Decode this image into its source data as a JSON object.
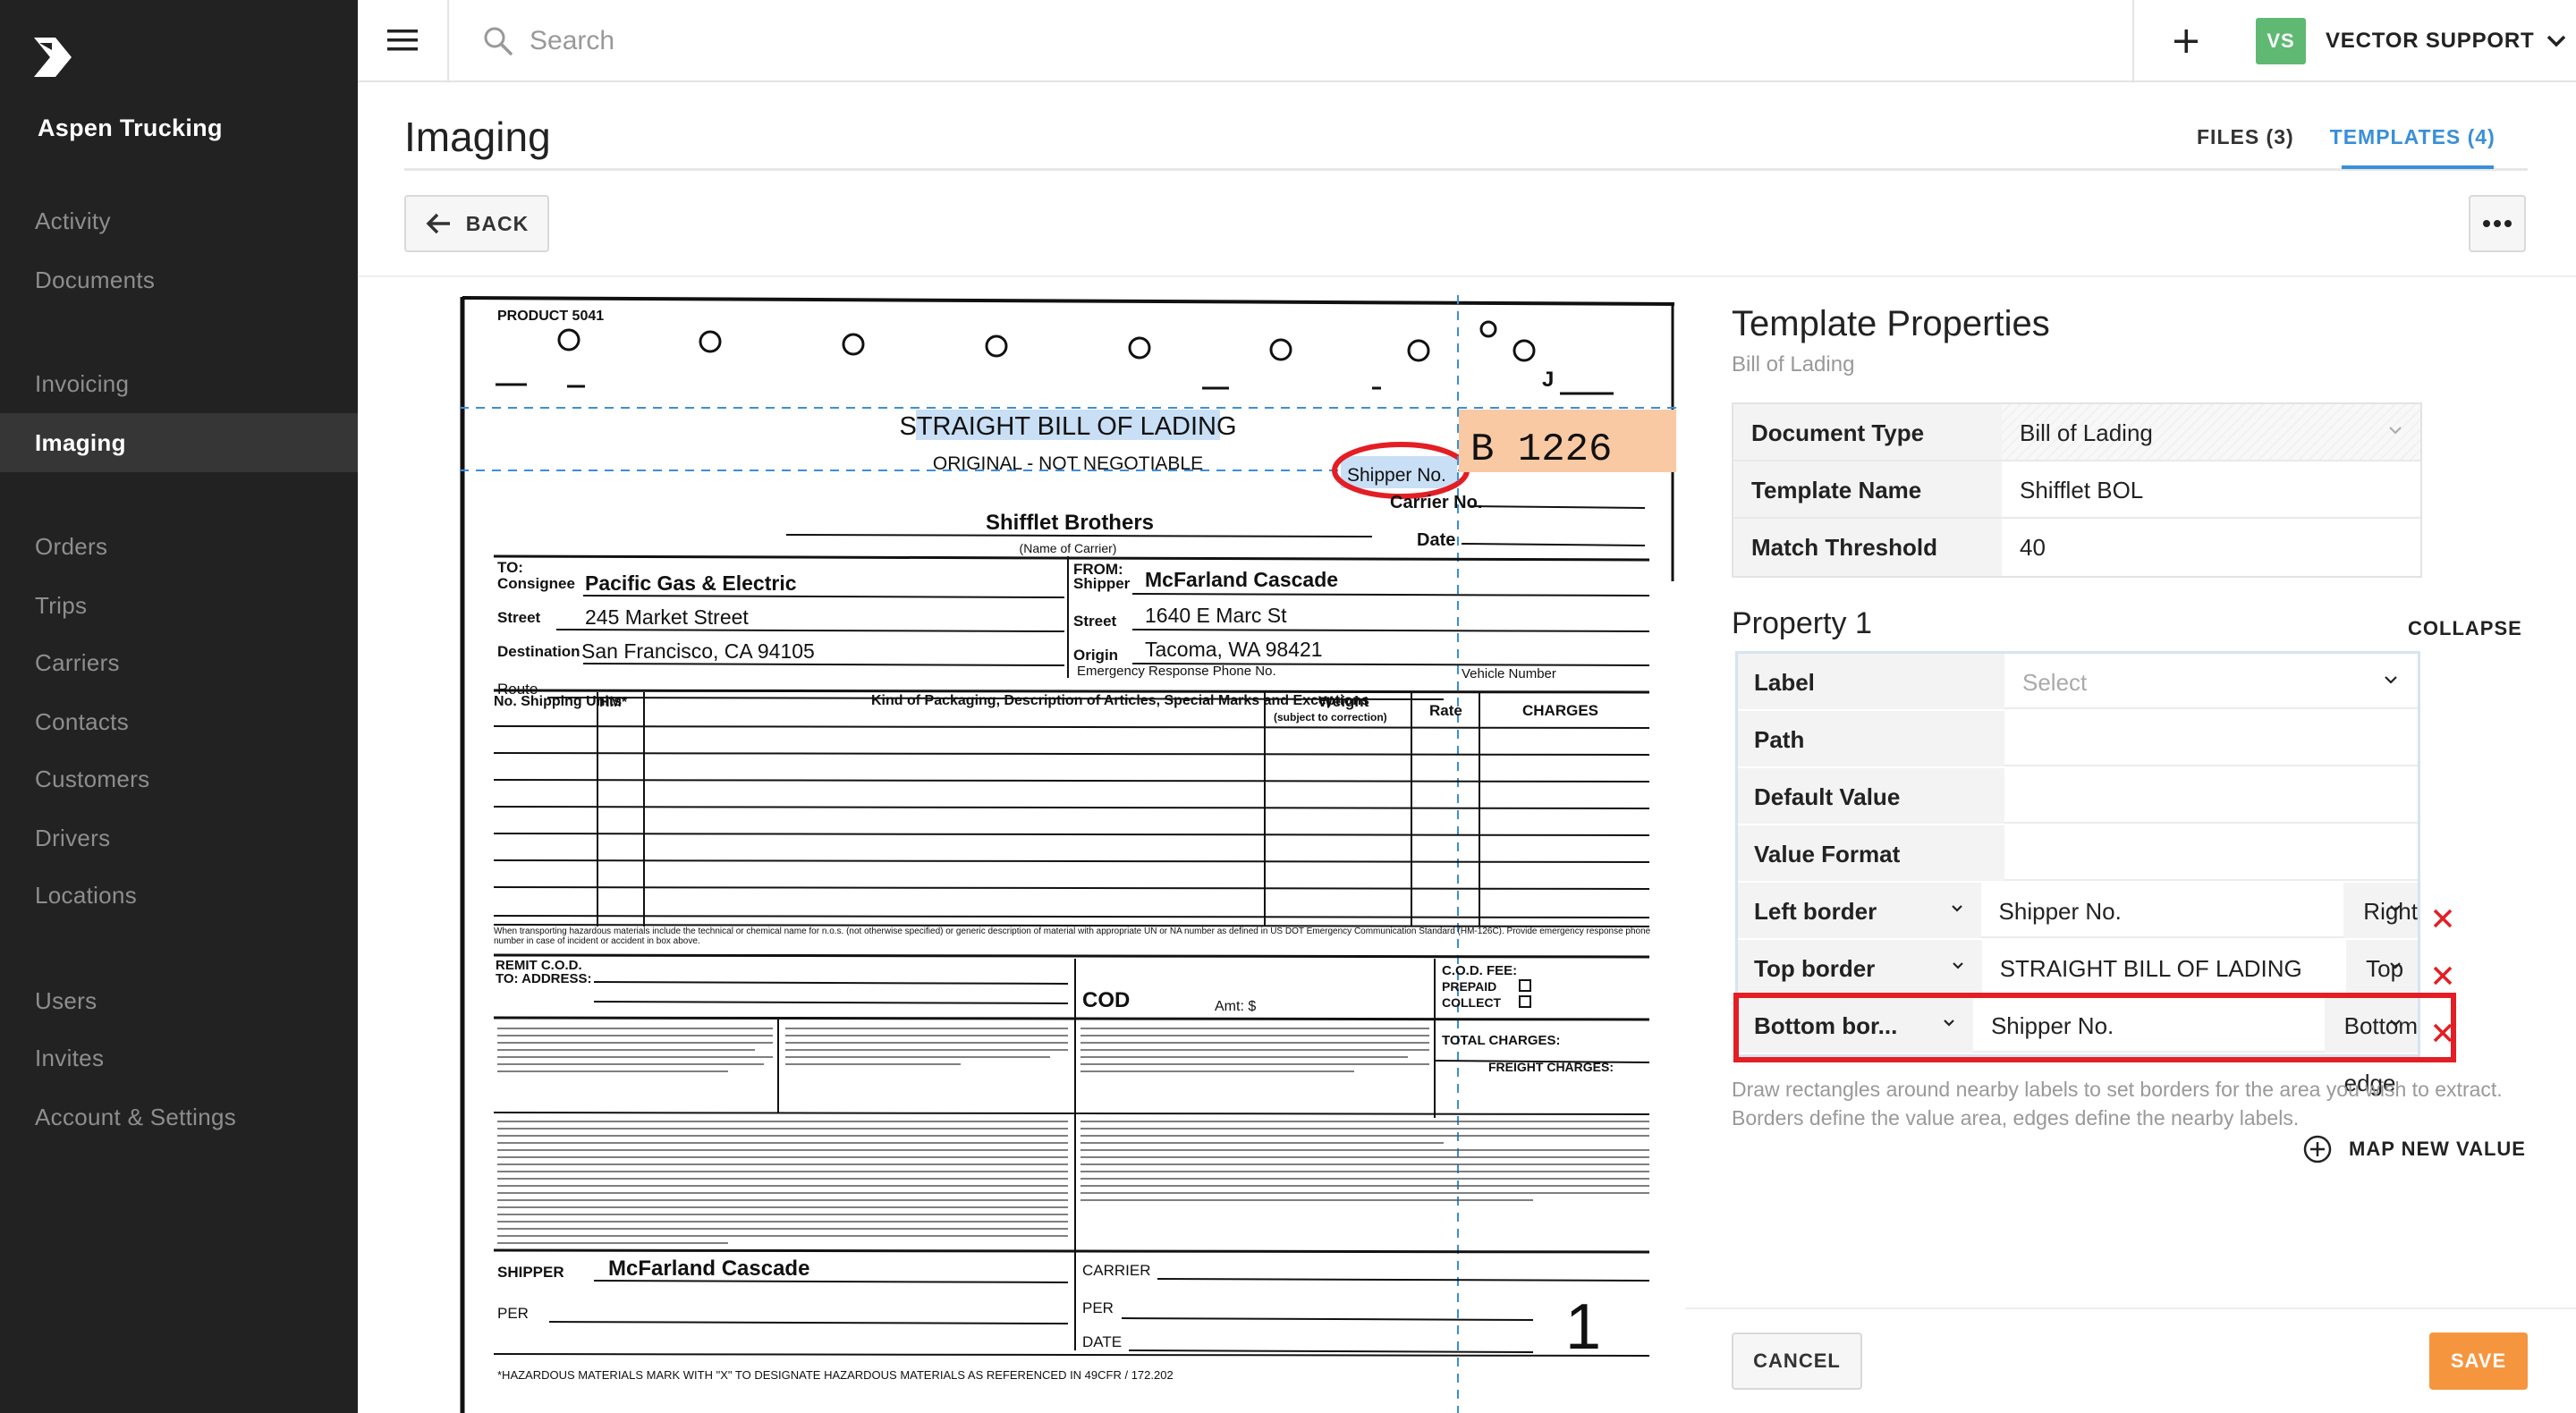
{
  "sidebar": {
    "company": "Aspen Trucking",
    "items": [
      {
        "label": "Activity"
      },
      {
        "label": "Documents"
      },
      {
        "label": "Invoicing"
      },
      {
        "label": "Imaging"
      },
      {
        "label": "Orders"
      },
      {
        "label": "Trips"
      },
      {
        "label": "Carriers"
      },
      {
        "label": "Contacts"
      },
      {
        "label": "Customers"
      },
      {
        "label": "Drivers"
      },
      {
        "label": "Locations"
      },
      {
        "label": "Users"
      },
      {
        "label": "Invites"
      },
      {
        "label": "Account & Settings"
      }
    ],
    "active": "Imaging"
  },
  "topbar": {
    "search_placeholder": "Search",
    "user_initials": "VS",
    "user_name": "VECTOR SUPPORT"
  },
  "header": {
    "title": "Imaging",
    "tabs": [
      {
        "label": "FILES (3)",
        "active": false
      },
      {
        "label": "TEMPLATES (4)",
        "active": true
      }
    ],
    "back_label": "BACK"
  },
  "document": {
    "product": "PRODUCT 5041",
    "title": "STRAIGHT BILL OF LADING",
    "subtitle": "ORIGINAL - NOT NEGOTIABLE",
    "shipper_no_label": "Shipper No.",
    "shipper_no_value": "B 1226",
    "carrier_no_label": "Carrier No.",
    "date_label": "Date",
    "carrier_name": "Shifflet Brothers",
    "carrier_caption": "(Name of Carrier)",
    "to_label": "TO:",
    "consignee_label": "Consignee",
    "consignee": "Pacific Gas & Electric",
    "street_label": "Street",
    "consignee_street": "245 Market Street",
    "destination_label": "Destination",
    "destination": "San Francisco, CA 94105",
    "route_label": "Route",
    "from_label": "FROM:",
    "shipper_label": "Shipper",
    "shipper": "McFarland Cascade",
    "shipper_street": "1640 E Marc St",
    "origin_label": "Origin",
    "origin": "Tacoma, WA 98421",
    "emergency_label": "Emergency Response Phone No.",
    "vehicle_label": "Vehicle Number",
    "col_units": "No. Shipping Units",
    "col_hm": "HM*",
    "col_kind": "Kind of Packaging, Description of Articles, Special Marks and Exceptions",
    "col_weight": "Weight",
    "col_weight_sub": "(subject to correction)",
    "col_rate": "Rate",
    "col_charges": "CHARGES",
    "hazmat_note": "When transporting hazardous materials include the technical or chemical name for n.o.s. (not otherwise specified) or generic description of material with appropriate UN or NA number as defined in US DOT Emergency Communication Standard (HM-126C). Provide emergency response phone number in case of incident or accident in box above.",
    "remit_label": "REMIT C.O.D. TO: ADDRESS:",
    "cod_label": "COD",
    "amt_label": "Amt: $",
    "cod_fee_label": "C.O.D. FEE:",
    "prepaid_label": "PREPAID",
    "collect_label": "COLLECT",
    "total_charges_label": "TOTAL CHARGES:",
    "freight_charges_label": "FREIGHT CHARGES:",
    "shipper_sig_label": "SHIPPER",
    "shipper_sig": "McFarland Cascade",
    "per_label": "PER",
    "carrier_sig_label": "CARRIER",
    "date_sig_label": "DATE",
    "page_number": "1",
    "footer_note": "*HAZARDOUS MATERIALS     MARK WITH \"X\" TO DESIGNATE HAZARDOUS MATERIALS AS REFERENCED IN 49CFR / 172.202"
  },
  "panel": {
    "title": "Template Properties",
    "subtitle": "Bill of Lading",
    "properties": [
      {
        "label": "Document Type",
        "value": "Bill of Lading"
      },
      {
        "label": "Template Name",
        "value": "Shifflet BOL"
      },
      {
        "label": "Match Threshold",
        "value": "40"
      }
    ],
    "property1_title": "Property 1",
    "collapse_label": "COLLAPSE",
    "fields": [
      {
        "label": "Label",
        "value": "Select"
      },
      {
        "label": "Path",
        "value": ""
      },
      {
        "label": "Default Value",
        "value": ""
      },
      {
        "label": "Value Format",
        "value": ""
      }
    ],
    "borders": [
      {
        "label": "Left border",
        "value": "Shipper No.",
        "edge": "Right edge"
      },
      {
        "label": "Top border",
        "value": "STRAIGHT BILL OF LADING",
        "edge": "Top edge"
      },
      {
        "label": "Bottom bor...",
        "value": "Shipper No.",
        "edge": "Bottom edge"
      }
    ],
    "help_text": "Draw rectangles around nearby labels to set borders for the area you wish to extract. Borders define the value area, edges define the nearby labels.",
    "map_new_value": "MAP NEW VALUE",
    "cancel_label": "CANCEL",
    "save_label": "SAVE"
  },
  "colors": {
    "sidebar_bg": "#222222",
    "accent_blue": "#3a8fd8",
    "save_orange": "#f5963f",
    "highlight_red": "#e31e24",
    "avatar_green": "#5fb973"
  }
}
